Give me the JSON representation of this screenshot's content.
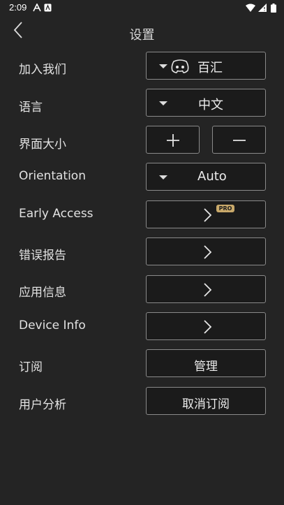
{
  "status_bar": {
    "time": "2:09",
    "left_icons": [
      "a-icon",
      "notification-icon"
    ],
    "right_icons": [
      "wifi-icon",
      "signal-icon",
      "battery-icon"
    ]
  },
  "header": {
    "title": "设置",
    "back_icon": "chevron-left-icon"
  },
  "settings": {
    "join_us": {
      "label": "加入我们",
      "value": "百汇",
      "icon": "discord-icon"
    },
    "language": {
      "label": "语言",
      "value": "中文"
    },
    "ui_size": {
      "label": "界面大小",
      "increase_symbol": "+",
      "decrease_symbol": "−"
    },
    "orientation": {
      "label": "Orientation",
      "value": "Auto"
    },
    "early_access": {
      "label": "Early Access",
      "badge": "PRO"
    },
    "error_report": {
      "label": "错误报告"
    },
    "app_info": {
      "label": "应用信息"
    },
    "device_info": {
      "label": "Device Info"
    },
    "subscription": {
      "label": "订阅",
      "button": "管理"
    },
    "user_analytics": {
      "label": "用户分析",
      "button": "取消订阅"
    }
  },
  "colors": {
    "background": "#242424",
    "control_background": "#1b1b1b",
    "control_border": "#8a8a8a",
    "pro_badge": "#c9a96a"
  }
}
